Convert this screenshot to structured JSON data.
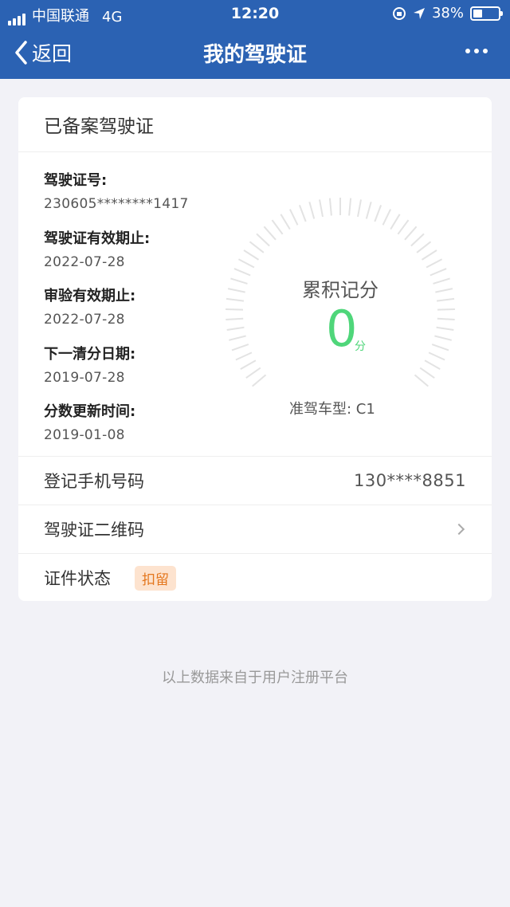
{
  "status_bar": {
    "carrier": "中国联通",
    "network": "4G",
    "time": "12:20",
    "battery": "38%",
    "battery_level": 0.38
  },
  "nav": {
    "back_label": "返回",
    "title": "我的驾驶证"
  },
  "card": {
    "header": "已备案驾驶证",
    "fields": [
      {
        "label": "驾驶证号:",
        "value": "230605********1417"
      },
      {
        "label": "驾驶证有效期止:",
        "value": "2022-07-28"
      },
      {
        "label": "审验有效期止:",
        "value": "2022-07-28"
      },
      {
        "label": "下一清分日期:",
        "value": "2019-07-28"
      },
      {
        "label": "分数更新时间:",
        "value": "2019-01-08"
      }
    ],
    "gauge": {
      "title": "累积记分",
      "score": "0",
      "unit": "分",
      "car_type": "准驾车型: C1"
    },
    "phone": {
      "label": "登记手机号码",
      "value": "130****8851"
    },
    "qrcode": {
      "label": "驾驶证二维码"
    },
    "cert_status": {
      "label": "证件状态",
      "badge": "扣留"
    }
  },
  "footer": "以上数据来自于用户注册平台",
  "colors": {
    "nav_bg": "#2b62b3",
    "score": "#4fd67a",
    "badge_bg": "#fde3cf",
    "badge_text": "#e4761d"
  }
}
